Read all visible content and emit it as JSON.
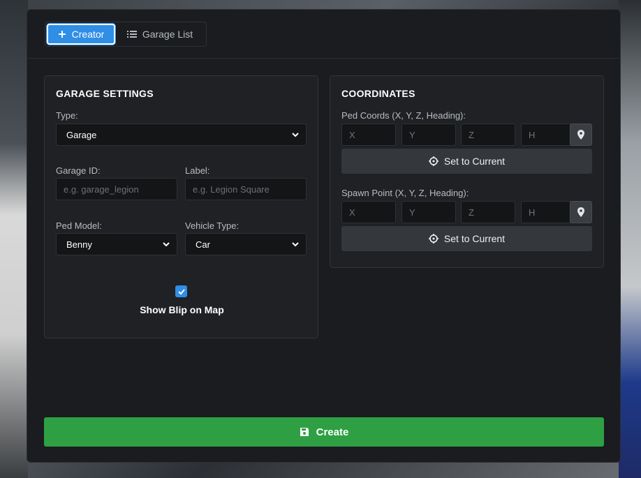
{
  "tabs": [
    {
      "label": "Creator",
      "icon": "plus-icon",
      "active": true
    },
    {
      "label": "Garage List",
      "icon": "list-icon",
      "active": false
    }
  ],
  "settings": {
    "title": "GARAGE SETTINGS",
    "type_label": "Type:",
    "type_value": "Garage",
    "garage_id_label": "Garage ID:",
    "garage_id_placeholder": "e.g. garage_legion",
    "label_label": "Label:",
    "label_placeholder": "e.g. Legion Square",
    "ped_model_label": "Ped Model:",
    "ped_model_value": "Benny",
    "vehicle_type_label": "Vehicle Type:",
    "vehicle_type_value": "Car",
    "show_blip_label": "Show Blip on Map",
    "show_blip_checked": true
  },
  "coords": {
    "title": "COORDINATES",
    "ped_label": "Ped Coords (X, Y, Z, Heading):",
    "spawn_label": "Spawn Point (X, Y, Z, Heading):",
    "placeholders": {
      "x": "X",
      "y": "Y",
      "z": "Z",
      "h": "H"
    },
    "set_current": "Set to Current"
  },
  "create_label": "Create",
  "colors": {
    "accent": "#2f8ee6",
    "success": "#2ea043",
    "panel": "#1a1c1f"
  }
}
